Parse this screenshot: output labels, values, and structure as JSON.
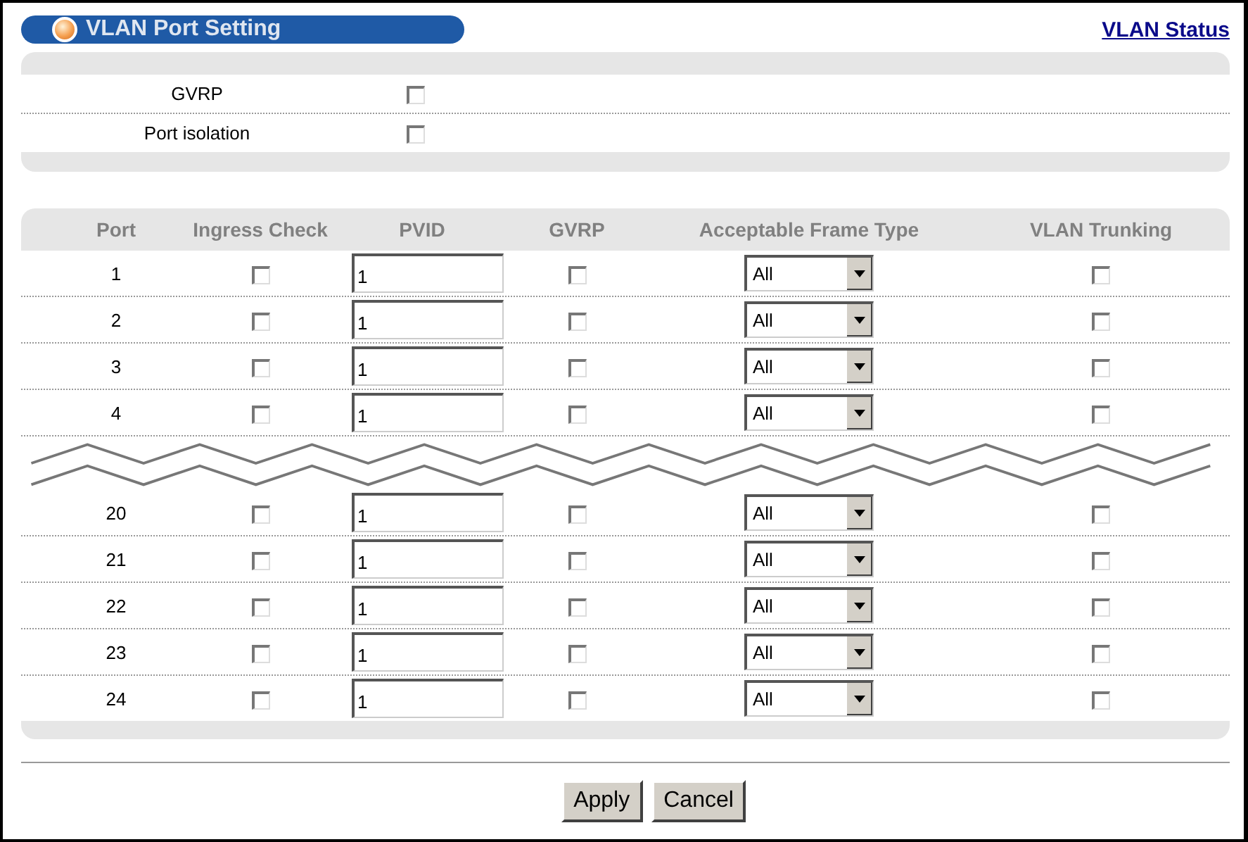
{
  "title": "VLAN Port Setting",
  "status_link": "VLAN Status",
  "global_settings": [
    {
      "label": "GVRP",
      "checked": false
    },
    {
      "label": "Port isolation",
      "checked": false
    }
  ],
  "table": {
    "columns": [
      "Port",
      "Ingress Check",
      "PVID",
      "GVRP",
      "Acceptable Frame Type",
      "VLAN Trunking"
    ],
    "row_groups": [
      [
        {
          "port": "1",
          "ingress_check": false,
          "pvid": "1",
          "gvrp": false,
          "frame_type": "All",
          "vlan_trunking": false
        },
        {
          "port": "2",
          "ingress_check": false,
          "pvid": "1",
          "gvrp": false,
          "frame_type": "All",
          "vlan_trunking": false
        },
        {
          "port": "3",
          "ingress_check": false,
          "pvid": "1",
          "gvrp": false,
          "frame_type": "All",
          "vlan_trunking": false
        },
        {
          "port": "4",
          "ingress_check": false,
          "pvid": "1",
          "gvrp": false,
          "frame_type": "All",
          "vlan_trunking": false
        }
      ],
      [
        {
          "port": "20",
          "ingress_check": false,
          "pvid": "1",
          "gvrp": false,
          "frame_type": "All",
          "vlan_trunking": false
        },
        {
          "port": "21",
          "ingress_check": false,
          "pvid": "1",
          "gvrp": false,
          "frame_type": "All",
          "vlan_trunking": false
        },
        {
          "port": "22",
          "ingress_check": false,
          "pvid": "1",
          "gvrp": false,
          "frame_type": "All",
          "vlan_trunking": false
        },
        {
          "port": "23",
          "ingress_check": false,
          "pvid": "1",
          "gvrp": false,
          "frame_type": "All",
          "vlan_trunking": false
        },
        {
          "port": "24",
          "ingress_check": false,
          "pvid": "1",
          "gvrp": false,
          "frame_type": "All",
          "vlan_trunking": false
        }
      ]
    ]
  },
  "buttons": [
    "Apply",
    "Cancel"
  ]
}
